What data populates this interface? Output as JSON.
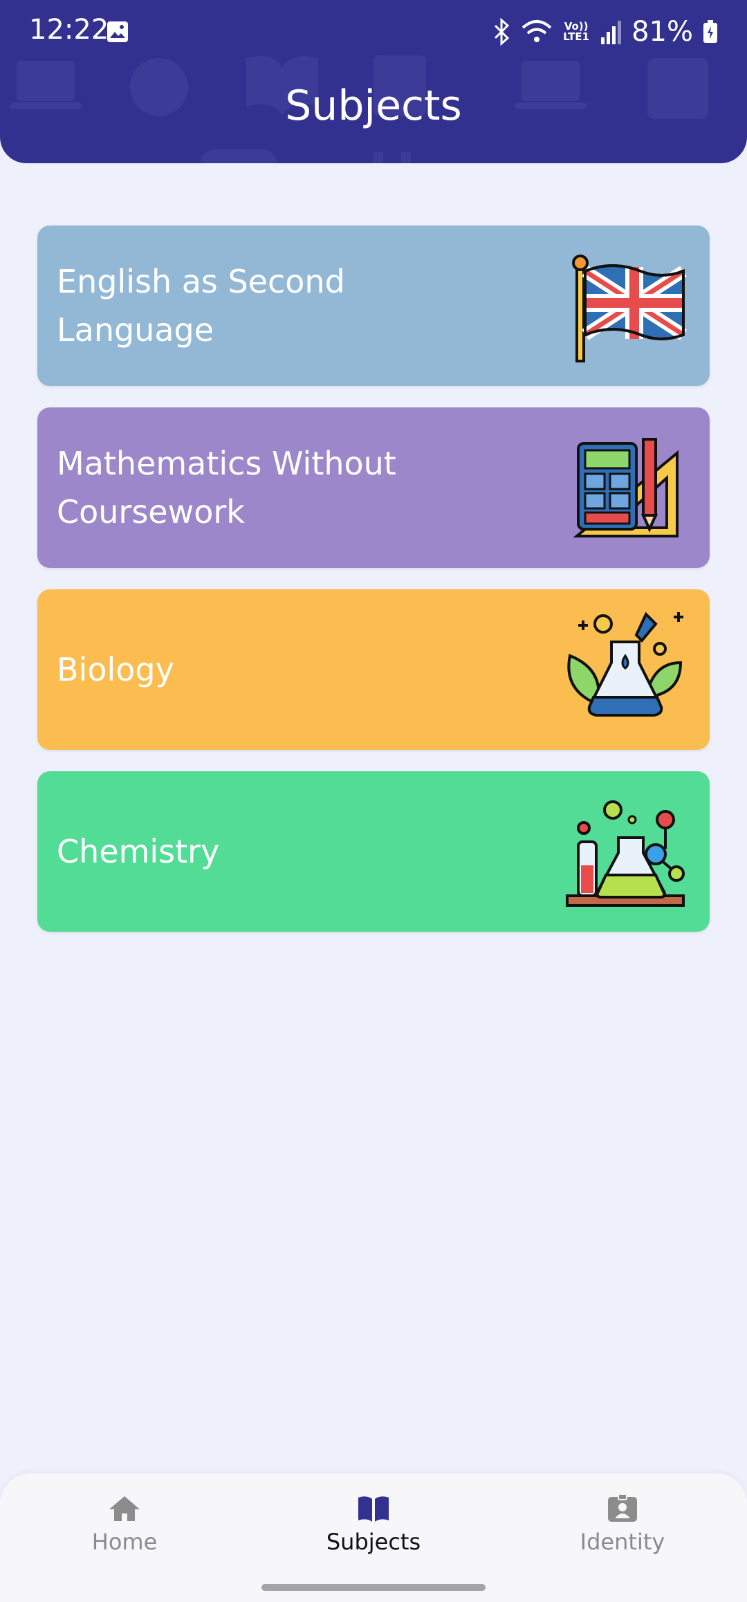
{
  "status_bar": {
    "time": "12:22",
    "battery": "81%",
    "network": "Vo)) LTE1",
    "icons": [
      "image-icon",
      "bluetooth-icon",
      "wifi-icon",
      "signal-icon",
      "battery-charging-icon"
    ]
  },
  "header": {
    "title": "Subjects",
    "background_color": "#33318f"
  },
  "subjects": [
    {
      "label": "English as Second Language",
      "color": "#93b8d6",
      "icon": "union-jack-flag-icon"
    },
    {
      "label": "Mathematics Without Coursework",
      "color": "#9b87c9",
      "icon": "calculator-ruler-icon"
    },
    {
      "label": "Biology",
      "color": "#fcbd50",
      "icon": "flask-leaves-icon"
    },
    {
      "label": "Chemistry",
      "color": "#53dc96",
      "icon": "lab-equipment-icon"
    }
  ],
  "bottom_nav": {
    "items": [
      {
        "label": "Home",
        "icon": "home-icon",
        "active": false
      },
      {
        "label": "Subjects",
        "icon": "book-icon",
        "active": true
      },
      {
        "label": "Identity",
        "icon": "id-badge-icon",
        "active": false
      }
    ],
    "active_color": "#33318f"
  }
}
